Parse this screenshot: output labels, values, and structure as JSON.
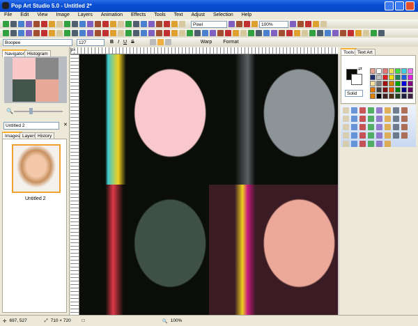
{
  "window": {
    "title": "Pop Art Studio 5.0 - Untitled 2*"
  },
  "menu": [
    "File",
    "Edit",
    "View",
    "Image",
    "Layers",
    "Animation",
    "Effects",
    "Tools",
    "Text",
    "Adjust",
    "Selection",
    "Help"
  ],
  "toolbar": {
    "unit": "Pixel",
    "zoom": "100%"
  },
  "text_toolbar": {
    "font": "Boopee",
    "size": "127",
    "warp": "Warp",
    "format": "Format"
  },
  "left_panel": {
    "tabs": [
      "Navigator",
      "Histogram"
    ],
    "document_select": "Untitled 2",
    "bottom_tabs": [
      "Images",
      "Layers",
      "History"
    ],
    "thumbnail_label": "Untitled 2"
  },
  "ruler": {
    "unit": "px"
  },
  "right_panel": {
    "tabs": [
      "Tools",
      "Text Art"
    ],
    "fill_mode": "Solid",
    "palette": [
      "#e8a090",
      "#ffffff",
      "#e87878",
      "#f0e060",
      "#40e040",
      "#40d0e0",
      "#f070f0",
      "#203070",
      "#c0c0c0",
      "#e02020",
      "#f0e000",
      "#208060",
      "#2060e0",
      "#e020e0",
      "#f8e0a0",
      "#808080",
      "#a01010",
      "#d08000",
      "#00a000",
      "#0000e0",
      "#800080",
      "#e07800",
      "#404040",
      "#801010",
      "#e05000",
      "#008000",
      "#000080",
      "#600060",
      "#e08000",
      "#000000",
      "#402020",
      "#503010",
      "#204020",
      "#202040",
      "#402040"
    ]
  },
  "status": {
    "coords": "697, 527",
    "size": "710 × 720",
    "zoom": "100%"
  }
}
